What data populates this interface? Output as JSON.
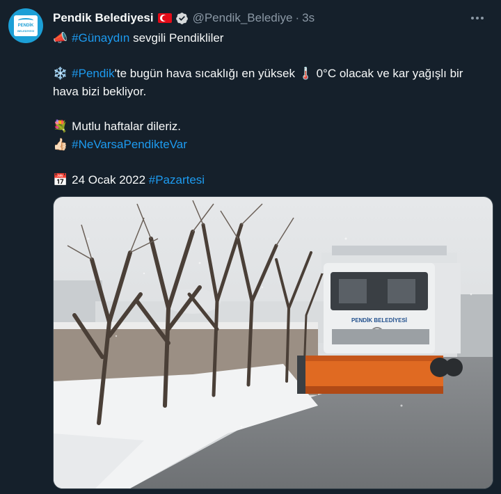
{
  "account": {
    "name": "Pendik Belediyesi",
    "handle": "@Pendik_Belediye",
    "separator": "·",
    "time": "3s",
    "avatar_text_top": "PENDİK",
    "avatar_text_bottom": "BELEDİYESİ"
  },
  "tweet": {
    "line1": {
      "emoji": "📣",
      "hashtag": "#Günaydın",
      "text": " sevgili Pendikliler"
    },
    "line2": {
      "emoji": "❄️",
      "hashtag": "#Pendik",
      "text_a": "'te bugün hava sıcaklığı en yüksek ",
      "emoji2": "🌡️",
      "text_b": " 0°C olacak ve kar yağışlı bir hava bizi bekliyor."
    },
    "line3": {
      "emoji": "💐",
      "text": "Mutlu haftalar dileriz."
    },
    "line4": {
      "emoji": "👍🏻",
      "hashtag": "#NeVarsaPendikteVar"
    },
    "line5": {
      "emoji": "📅",
      "text": "24 Ocak 2022 ",
      "hashtag": "#Pazartesi"
    }
  },
  "photo": {
    "truck_label": "PENDİK BELEDİYESİ"
  },
  "colors": {
    "background": "#15202b",
    "link": "#1d9bf0",
    "muted": "#8b98a5",
    "text": "#f7f9f9",
    "verified": "#1d9bf0",
    "plow": "#e06a22"
  }
}
